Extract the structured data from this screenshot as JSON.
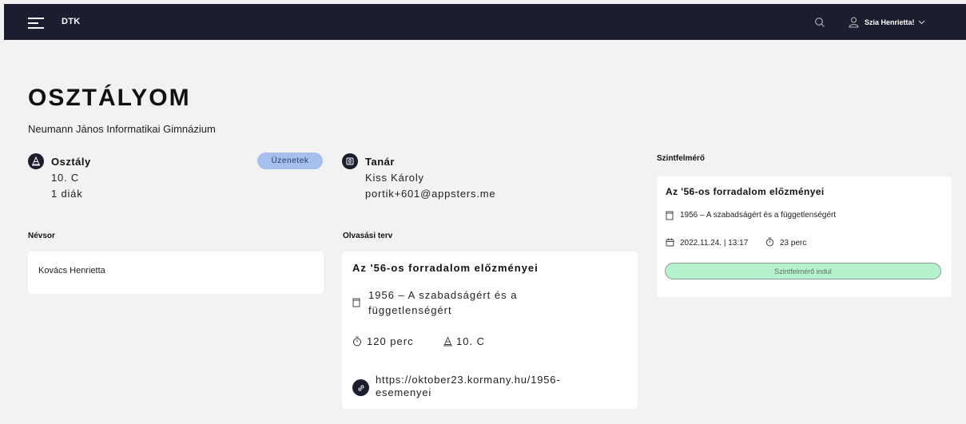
{
  "header": {
    "brand": "DTK",
    "greeting": "Szia Henrietta!",
    "icons": {
      "menu": "menu-icon",
      "search": "search-icon",
      "user": "user-icon",
      "chevron": "chevron-down-icon"
    }
  },
  "page": {
    "title": "OSZTÁLYOM",
    "school": "Neumann János Informatikai Gimnázium"
  },
  "class_info": {
    "title": "Osztály",
    "class_name": "10. C",
    "students": "1 diák",
    "messages_button": "Üzenetek"
  },
  "teacher": {
    "title": "Tanár",
    "name": "Kiss Károly",
    "email": "portik+601@appsters.me"
  },
  "roster": {
    "label": "Névsor",
    "students": [
      "Kovács Henrietta"
    ]
  },
  "reading_plan": {
    "label": "Olvasási terv",
    "title": "Az '56-os forradalom előzményei",
    "book_line1": "1956 – A szabadságért és a",
    "book_line2": "függetlenségért",
    "duration": "120 perc",
    "class": "10. C",
    "link_line1": "https://oktober23.kormany.hu/1956-",
    "link_line2": "esemenyei"
  },
  "assessment": {
    "label": "Szintfelmérő",
    "title": "Az '56-os forradalom előzményei",
    "book": "1956 – A szabadságért és a függetlenségért",
    "datetime": "2022.11.24. | 13:17",
    "duration": "23 perc",
    "start_button": "Szintfelmérő indul",
    "colors": {
      "button_bg": "#b6f2cd",
      "accent": "#a6c0ee",
      "dark": "#1c1d2e"
    }
  }
}
